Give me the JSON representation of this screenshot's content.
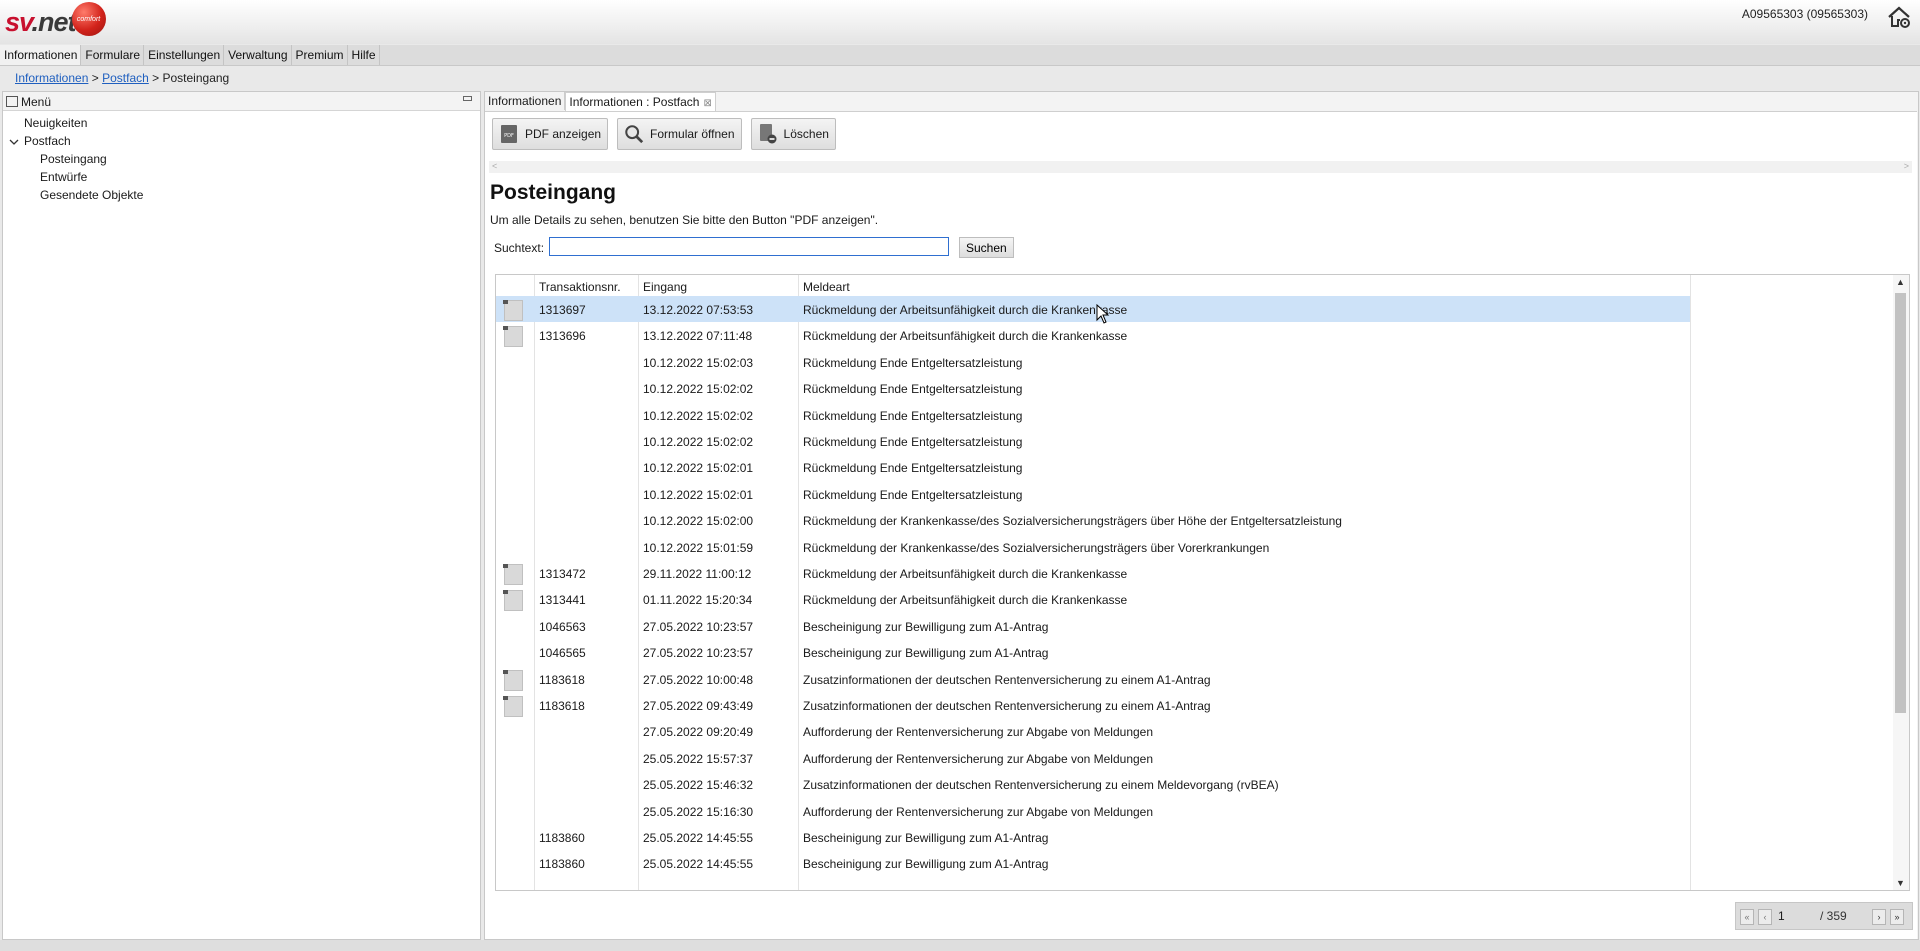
{
  "header": {
    "logo_text_sv": "sv",
    "logo_text_net": ".net",
    "logo_badge": "comfort",
    "account": "A09565303 (09565303)"
  },
  "menubar": {
    "items": [
      "Informationen",
      "Formulare",
      "Einstellungen",
      "Verwaltung",
      "Premium",
      "Hilfe"
    ]
  },
  "breadcrumb": {
    "items": [
      "Informationen",
      "Postfach",
      "Posteingang"
    ],
    "separator": ">"
  },
  "leftpanel": {
    "title": "Menü",
    "tree": {
      "neuigkeiten": "Neuigkeiten",
      "postfach": "Postfach",
      "posteingang": "Posteingang",
      "entwuerfe": "Entwürfe",
      "gesendete": "Gesendete Objekte"
    }
  },
  "tabs": [
    "Informationen",
    "Informationen : Postfach"
  ],
  "toolbar": {
    "pdf": "PDF anzeigen",
    "formular": "Formular öffnen",
    "loeschen": "Löschen"
  },
  "page": {
    "title": "Posteingang",
    "hint": "Um alle Details zu sehen, benutzen Sie bitte den Button \"PDF anzeigen\".",
    "search_label": "Suchtext:",
    "search_value": "",
    "search_button": "Suchen"
  },
  "table": {
    "columns": [
      "Transaktionsnr.",
      "Eingang",
      "Meldeart"
    ],
    "rows": [
      {
        "doc": true,
        "nr": "1313697",
        "eingang": "13.12.2022 07:53:53",
        "meldeart": "Rückmeldung der Arbeitsunfähigkeit durch die Krankenkasse",
        "selected": true
      },
      {
        "doc": true,
        "nr": "1313696",
        "eingang": "13.12.2022 07:11:48",
        "meldeart": "Rückmeldung der Arbeitsunfähigkeit durch die Krankenkasse"
      },
      {
        "doc": false,
        "nr": "",
        "eingang": "10.12.2022 15:02:03",
        "meldeart": "Rückmeldung Ende Entgeltersatzleistung"
      },
      {
        "doc": false,
        "nr": "",
        "eingang": "10.12.2022 15:02:02",
        "meldeart": "Rückmeldung Ende Entgeltersatzleistung"
      },
      {
        "doc": false,
        "nr": "",
        "eingang": "10.12.2022 15:02:02",
        "meldeart": "Rückmeldung Ende Entgeltersatzleistung"
      },
      {
        "doc": false,
        "nr": "",
        "eingang": "10.12.2022 15:02:02",
        "meldeart": "Rückmeldung Ende Entgeltersatzleistung"
      },
      {
        "doc": false,
        "nr": "",
        "eingang": "10.12.2022 15:02:01",
        "meldeart": "Rückmeldung Ende Entgeltersatzleistung"
      },
      {
        "doc": false,
        "nr": "",
        "eingang": "10.12.2022 15:02:01",
        "meldeart": "Rückmeldung Ende Entgeltersatzleistung"
      },
      {
        "doc": false,
        "nr": "",
        "eingang": "10.12.2022 15:02:00",
        "meldeart": "Rückmeldung der Krankenkasse/des Sozialversicherungsträgers über Höhe der Entgeltersatzleistung"
      },
      {
        "doc": false,
        "nr": "",
        "eingang": "10.12.2022 15:01:59",
        "meldeart": "Rückmeldung der Krankenkasse/des Sozialversicherungsträgers über Vorerkrankungen"
      },
      {
        "doc": true,
        "nr": "1313472",
        "eingang": "29.11.2022 11:00:12",
        "meldeart": "Rückmeldung der Arbeitsunfähigkeit durch die Krankenkasse"
      },
      {
        "doc": true,
        "nr": "1313441",
        "eingang": "01.11.2022 15:20:34",
        "meldeart": "Rückmeldung der Arbeitsunfähigkeit durch die Krankenkasse"
      },
      {
        "doc": false,
        "nr": "1046563",
        "eingang": "27.05.2022 10:23:57",
        "meldeart": "Bescheinigung zur Bewilligung zum A1-Antrag"
      },
      {
        "doc": false,
        "nr": "1046565",
        "eingang": "27.05.2022 10:23:57",
        "meldeart": "Bescheinigung zur Bewilligung zum A1-Antrag"
      },
      {
        "doc": true,
        "nr": "1183618",
        "eingang": "27.05.2022 10:00:48",
        "meldeart": "Zusatzinformationen der deutschen Rentenversicherung zu einem A1-Antrag"
      },
      {
        "doc": true,
        "nr": "1183618",
        "eingang": "27.05.2022 09:43:49",
        "meldeart": "Zusatzinformationen der deutschen Rentenversicherung zu einem A1-Antrag"
      },
      {
        "doc": false,
        "nr": "",
        "eingang": "27.05.2022 09:20:49",
        "meldeart": "Aufforderung der Rentenversicherung zur Abgabe von Meldungen"
      },
      {
        "doc": false,
        "nr": "",
        "eingang": "25.05.2022 15:57:37",
        "meldeart": "Aufforderung der Rentenversicherung zur Abgabe von Meldungen"
      },
      {
        "doc": false,
        "nr": "",
        "eingang": "25.05.2022 15:46:32",
        "meldeart": "Zusatzinformationen der deutschen Rentenversicherung zu einem Meldevorgang (rvBEA)"
      },
      {
        "doc": false,
        "nr": "",
        "eingang": "25.05.2022 15:16:30",
        "meldeart": "Aufforderung der Rentenversicherung zur Abgabe von Meldungen"
      },
      {
        "doc": false,
        "nr": "1183860",
        "eingang": "25.05.2022 14:45:55",
        "meldeart": "Bescheinigung zur Bewilligung zum A1-Antrag"
      },
      {
        "doc": false,
        "nr": "1183860",
        "eingang": "25.05.2022 14:45:55",
        "meldeart": "Bescheinigung zur Bewilligung zum A1-Antrag"
      }
    ]
  },
  "pager": {
    "current": "1",
    "total": "/ 359"
  }
}
